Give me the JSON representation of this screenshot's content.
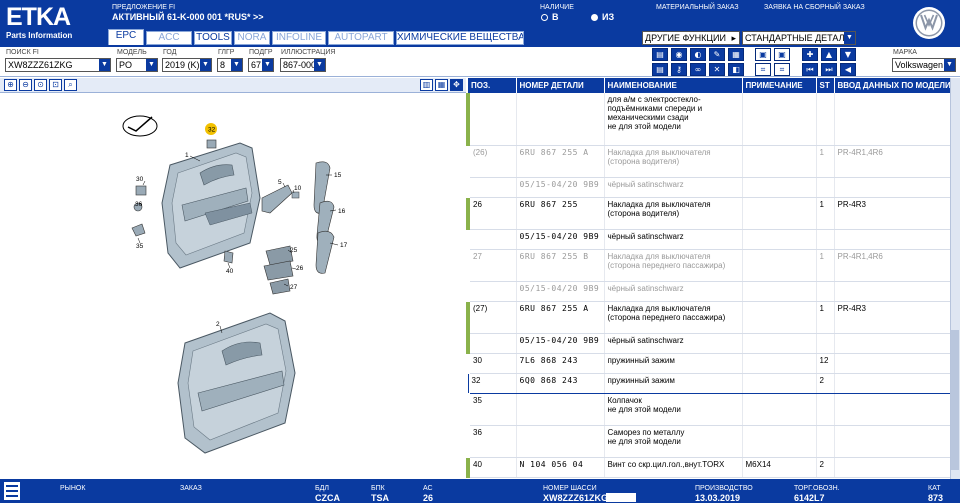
{
  "app": {
    "logo_main": "ETKA",
    "logo_sub": "Parts Information"
  },
  "header": {
    "proposal_label": "ПРЕДЛОЖЕНИЕ FI",
    "proposal_value": "АКТИВНЫЙ  61-K-000 001 *RUS* >>",
    "availability_label": "НАЛИЧИЕ",
    "radio_in": "В",
    "radio_from": "ИЗ",
    "material_order_label": "МАТЕРИАЛЬНЫЙ ЗАКАЗ",
    "assembly_order_label": "ЗАЯВКА НА СБОРНЫЙ ЗАКАЗ",
    "other_functions": "ДРУГИЕ ФУНКЦИИ",
    "standard_parts": "СТАНДАРТНЫЕ ДЕТАЛИ",
    "brand_icon": "vw-logo-icon"
  },
  "tabs": [
    {
      "label": "EPC",
      "active": true
    },
    {
      "label": "ACC",
      "dim": true
    },
    {
      "label": "TOOLS"
    },
    {
      "label": "NORA",
      "dim": true
    },
    {
      "label": "INFOLINE",
      "dim": true
    },
    {
      "label": "AUTOPART",
      "dim": true
    },
    {
      "label": "ХИМИЧЕСКИЕ ВЕЩЕСТВА"
    }
  ],
  "filters": {
    "search_fi_label": "ПОИСК FI",
    "search_fi_value": "XW8ZZZ61ZKG",
    "model_label": "МОДЕЛЬ",
    "model_value": "PO",
    "year_label": "ГОД",
    "year_value": "2019 (K)",
    "main_group_label": "ГЛГР",
    "main_group_value": "8",
    "sub_group_label": "ПОДГР",
    "sub_group_value": "67",
    "illustration_label": "ИЛЛЮСТРАЦИЯ",
    "illustration_value": "867-000",
    "brand_label": "МАРКА",
    "brand_value": "Volkswagen"
  },
  "illustration": {
    "callouts": [
      "32",
      "1",
      "30",
      "36",
      "35",
      "40",
      "5",
      "10",
      "15",
      "16",
      "17",
      "25",
      "26",
      "27",
      "2"
    ]
  },
  "table": {
    "columns": [
      "ПОЗ.",
      "НОМЕР ДЕТАЛИ",
      "НАИМЕНОВАНИЕ",
      "ПРИМЕЧАНИЕ",
      "ST",
      "ВВОД ДАННЫХ ПО МОДЕЛИ"
    ],
    "rows": [
      {
        "pos": "",
        "part": "",
        "name": "для а/м с электростекло-\nподъёмниками спереди и\nмеханическими сзади\nне для этой модели",
        "note": "",
        "st": "",
        "model": "",
        "green": true,
        "gray": false
      },
      {
        "pos": "(26)",
        "part": "6RU 867 255 A",
        "name": "Накладка для выключателя\n(сторона водителя)",
        "note": "",
        "st": "1",
        "model": "PR-4R1,4R6",
        "green": false,
        "gray": true
      },
      {
        "pos": "",
        "part": "05/15-04/20 9B9",
        "name": "чёрный satinschwarz",
        "note": "",
        "st": "",
        "model": "",
        "green": false,
        "gray": true
      },
      {
        "pos": "26",
        "part": "6RU 867 255",
        "name": "Накладка для выключателя\n(сторона водителя)",
        "note": "",
        "st": "1",
        "model": "PR-4R3",
        "green": true,
        "gray": false
      },
      {
        "pos": "",
        "part": "05/15-04/20 9B9",
        "name": "чёрный satinschwarz",
        "note": "",
        "st": "",
        "model": "",
        "green": false,
        "gray": false
      },
      {
        "pos": "27",
        "part": "6RU 867 255 B",
        "name": "Накладка для выключателя\n(сторона переднего пассажира)",
        "note": "",
        "st": "1",
        "model": "PR-4R1,4R6",
        "green": false,
        "gray": true
      },
      {
        "pos": "",
        "part": "05/15-04/20 9B9",
        "name": "чёрный satinschwarz",
        "note": "",
        "st": "",
        "model": "",
        "green": false,
        "gray": true
      },
      {
        "pos": "(27)",
        "part": "6RU 867 255 A",
        "name": "Накладка для выключателя\n(сторона переднего пассажира)",
        "note": "",
        "st": "1",
        "model": "PR-4R3",
        "green": true,
        "gray": false
      },
      {
        "pos": "",
        "part": "05/15-04/20 9B9",
        "name": "чёрный satinschwarz",
        "note": "",
        "st": "",
        "model": "",
        "green": true,
        "gray": false
      },
      {
        "pos": "30",
        "part": "7L6 868 243",
        "name": "пружинный зажим",
        "note": "",
        "st": "12",
        "model": "",
        "green": false,
        "gray": false
      },
      {
        "pos": "32",
        "part": "6Q0 868 243",
        "name": "пружинный зажим",
        "note": "",
        "st": "2",
        "model": "",
        "green": false,
        "gray": false,
        "selected": true
      },
      {
        "pos": "35",
        "part": "",
        "name": "Колпачок\nне для этой модели",
        "note": "",
        "st": "",
        "model": "",
        "green": false,
        "gray": false
      },
      {
        "pos": "36",
        "part": "",
        "name": "Саморез по металлу\nне для этой модели",
        "note": "",
        "st": "",
        "model": "",
        "green": false,
        "gray": false
      },
      {
        "pos": "40",
        "part": "N  104 056 04",
        "name": "Винт со скр.цил.гол.,внут.TORX",
        "note": "M6X14",
        "st": "2",
        "model": "",
        "green": true,
        "gray": false
      }
    ]
  },
  "status": {
    "market_label": "РЫНОК",
    "market_value": "",
    "order_label": "ЗАКАЗ",
    "order_value": "",
    "engine_label": "БДЛ",
    "engine_value": "CZCA",
    "gearbox_label": "БПК",
    "gearbox_value": "TSA",
    "ac_label": "АС",
    "ac_value": "26",
    "vin_label": "НОМЕР ШАССИ",
    "vin_value": "XW8ZZZ61ZKG",
    "production_label": "ПРОИЗВОДСТВО",
    "production_value": "13.03.2019",
    "trade_label": "ТОРГ.ОБОЗН.",
    "trade_value": "6142L7",
    "cat_label": "КАТ",
    "cat_value": "873"
  },
  "colors": {
    "brand_blue": "#0a3aa0",
    "accent_green": "#8ab24b",
    "badge_yellow": "#f2c100"
  }
}
